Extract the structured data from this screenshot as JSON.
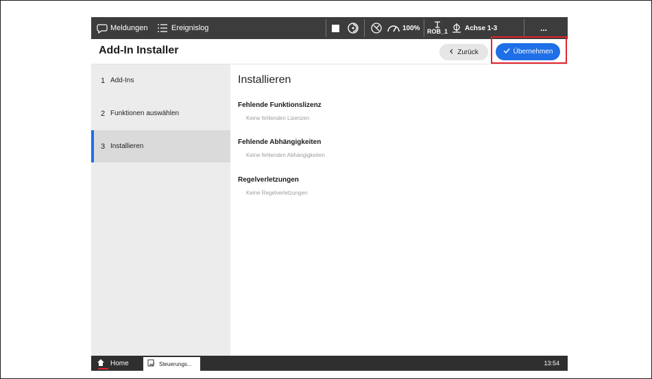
{
  "topbar": {
    "messages_label": "Meldungen",
    "eventlog_label": "Ereignislog",
    "speed_label": "100%",
    "robot_label": "ROB_1",
    "axes_label": "Achse 1-3",
    "more_label": "..."
  },
  "header": {
    "title": "Add-In Installer",
    "back_label": "Zurück",
    "apply_label": "Übernehmen"
  },
  "steps": [
    {
      "num": "1",
      "label": "Add-Ins"
    },
    {
      "num": "2",
      "label": "Funktionen auswählen"
    },
    {
      "num": "3",
      "label": "Installieren"
    }
  ],
  "content": {
    "title": "Installieren",
    "sections": [
      {
        "heading": "Fehlende Funktionslizenz",
        "value": "Keine fehlenden Lizenzen"
      },
      {
        "heading": "Fehlende Abhängigkeiten",
        "value": "Keine fehlenden Abhängigkeiten"
      },
      {
        "heading": "Regelverletzungen",
        "value": "Keine Regelverletzungen"
      }
    ]
  },
  "taskbar": {
    "home_label": "Home",
    "task_label": "Steuerungs...",
    "clock": "13:54"
  },
  "colors": {
    "accent": "#1e6fe8",
    "highlight": "#e0232c",
    "topbar": "#3c3c3c"
  },
  "icons": [
    "messages-icon",
    "list-icon",
    "stop-icon",
    "motor-icon",
    "jog-icon",
    "speed-gauge-icon",
    "robot-icon",
    "axes-icon",
    "check-icon",
    "chevron-left-icon",
    "home-icon",
    "app-icon"
  ]
}
